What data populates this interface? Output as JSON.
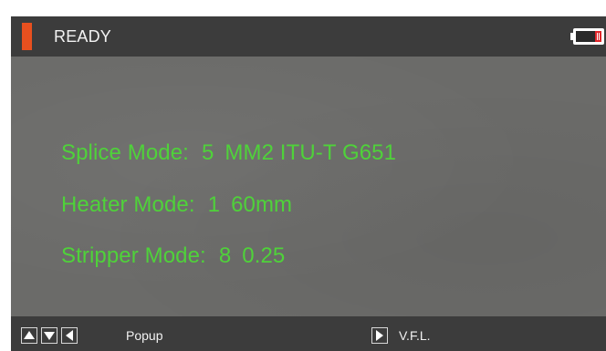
{
  "titlebar": {
    "status": "READY",
    "status_color": "#e8501f",
    "battery_icon": "battery-low-icon",
    "battery_level_fraction": 0.2
  },
  "modes": {
    "splice": {
      "label": "Splice Mode:",
      "number": "5",
      "value": "MM2 ITU-T G651"
    },
    "heater": {
      "label": "Heater Mode:",
      "number": "1",
      "value": "60mm"
    },
    "stripper": {
      "label": "Stripper Mode:",
      "number": "8",
      "value": "0.25"
    }
  },
  "footer": {
    "left_keys": [
      "arrow-up-icon",
      "arrow-down-icon",
      "arrow-left-icon"
    ],
    "left_label": "Popup",
    "right_key": "arrow-right-icon",
    "right_label": "V.F.L."
  },
  "colors": {
    "mode_text": "#4fd23a",
    "panel": "#6b6b69",
    "bars": "#3c3c3c",
    "battery_fill": "#e0262b"
  }
}
